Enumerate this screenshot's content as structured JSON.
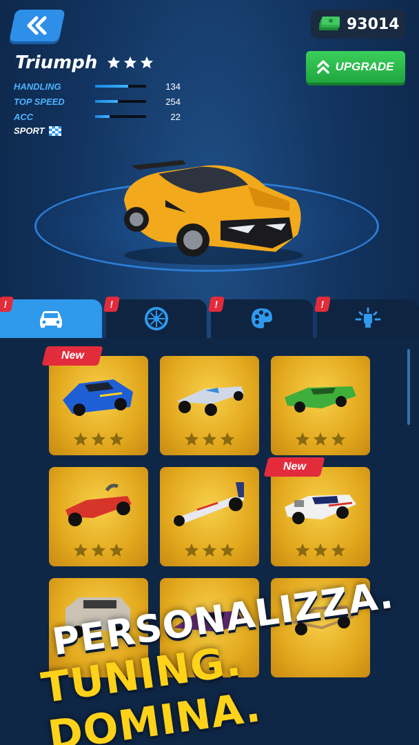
{
  "header": {
    "currency": "93014",
    "upgrade_label": "UPGRADE"
  },
  "car": {
    "name": "Triumph",
    "stars": 3,
    "stats": [
      {
        "label": "HANDLING",
        "value": "134",
        "fill": 0.65
      },
      {
        "label": "TOP SPEED",
        "value": "254",
        "fill": 0.45
      },
      {
        "label": "ACC",
        "value": "22",
        "fill": 0.28
      }
    ],
    "class_label": "SPORT",
    "color": "#f2a91c"
  },
  "tabs": [
    {
      "name": "cars",
      "icon": "car-icon",
      "active": true,
      "badge": "!"
    },
    {
      "name": "wheels",
      "icon": "wheel-icon",
      "active": false,
      "badge": "!"
    },
    {
      "name": "paint",
      "icon": "palette-icon",
      "active": false,
      "badge": "!"
    },
    {
      "name": "lights",
      "icon": "light-icon",
      "active": false,
      "badge": "!"
    }
  ],
  "garage": {
    "cards": [
      {
        "car": "blue-race-car",
        "color": "#1f5fd6",
        "new": true
      },
      {
        "car": "silver-open-wheel",
        "color": "#cfd8e6",
        "new": false
      },
      {
        "car": "green-lowrider",
        "color": "#3fae3a",
        "new": false
      },
      {
        "car": "red-hot-rod",
        "color": "#d8352a",
        "new": false
      },
      {
        "car": "dragster",
        "color": "#e8e8f0",
        "new": false
      },
      {
        "car": "white-muscle-car",
        "color": "#f1f1f1",
        "new": true
      },
      {
        "car": "grey-suv",
        "color": "#c9c2b5",
        "new": false
      },
      {
        "car": "purple-supercar",
        "color": "#6a2f7a",
        "new": false
      },
      {
        "car": "tan-buggy",
        "color": "#b58c55",
        "new": false
      }
    ],
    "new_label": "New"
  },
  "banner": {
    "line1": "PERSONALIZZA.",
    "line2": "TUNING. DOMINA."
  }
}
